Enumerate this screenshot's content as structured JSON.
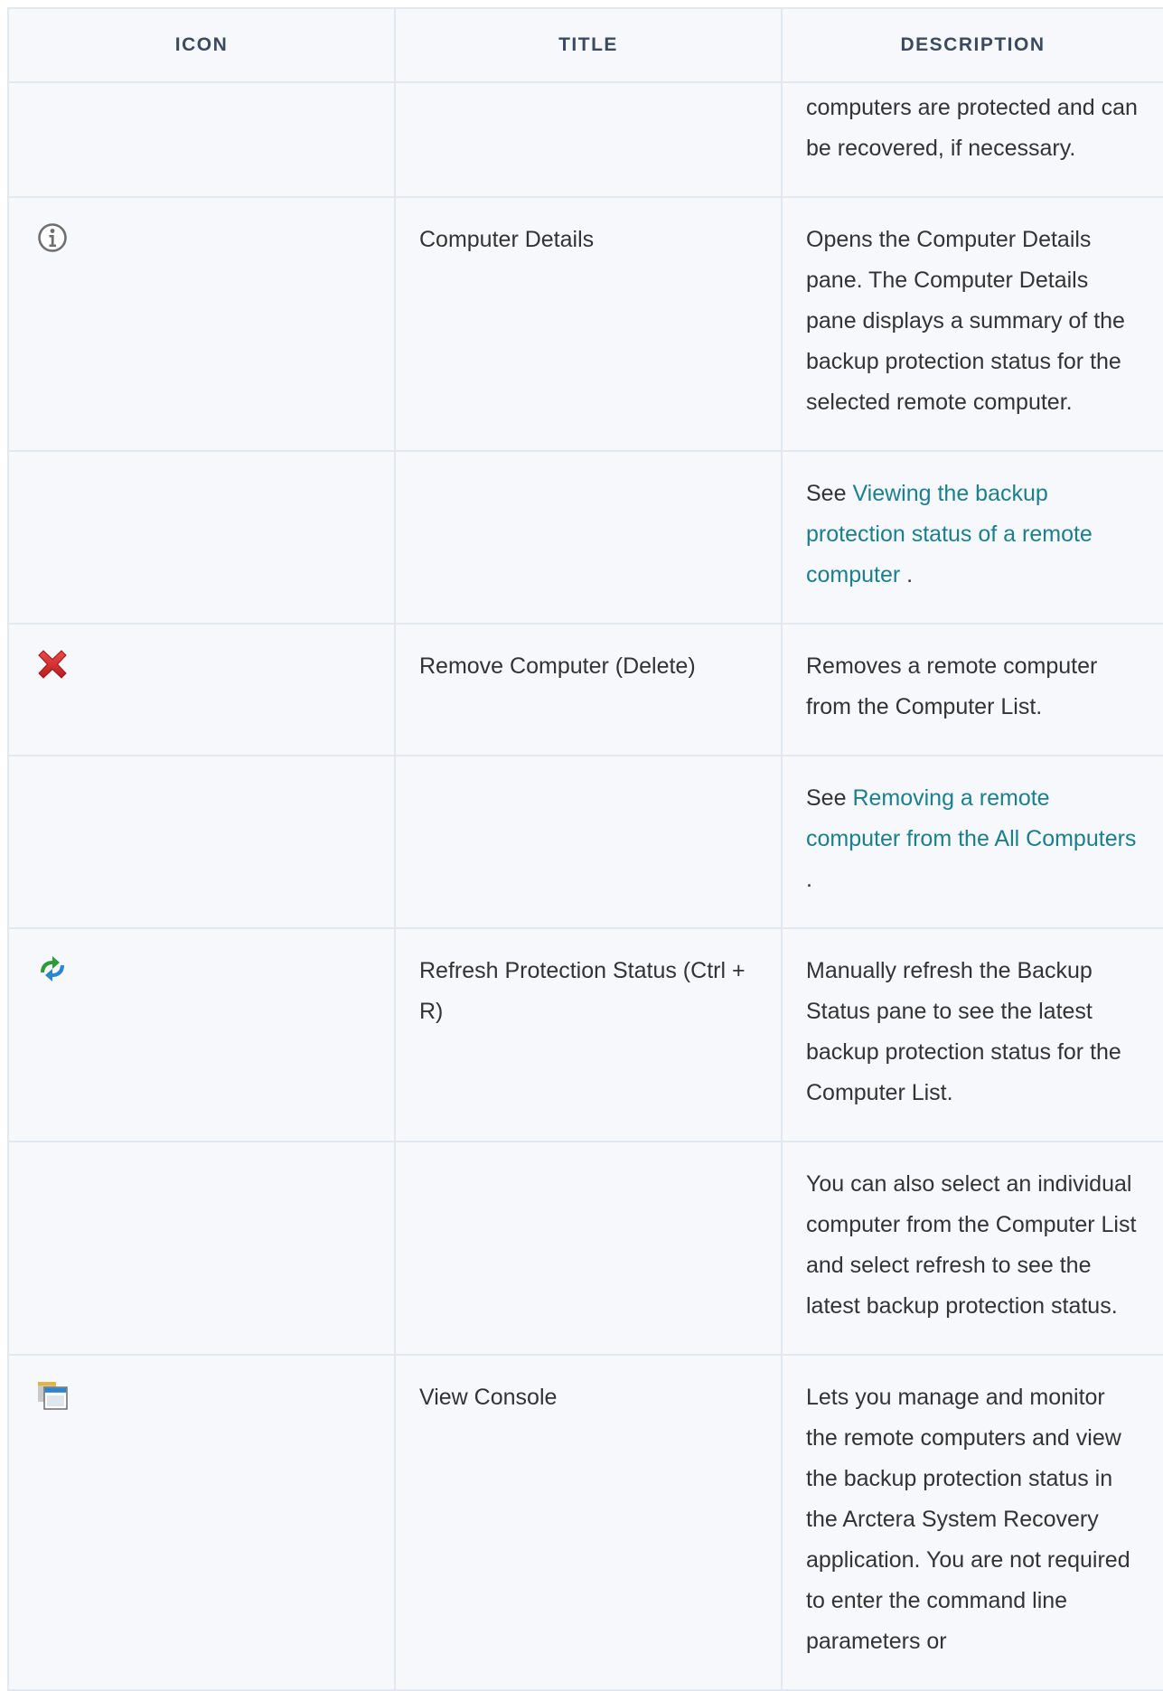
{
  "columns": {
    "icon": "ICON",
    "title": "TITLE",
    "description": "DESCRIPTION"
  },
  "rows": [
    {
      "icon": "",
      "title": "",
      "description": "computers are protected and can be recovered, if necessary."
    },
    {
      "icon": "info-icon",
      "title": "Computer Details",
      "description": "Opens the Computer Details pane. The Computer Details pane displays a summary of the backup protection status for the selected remote computer."
    },
    {
      "icon": "",
      "title": "",
      "see_prefix": "See",
      "link": "Viewing the backup protection status of a remote computer",
      "see_suffix": "."
    },
    {
      "icon": "red-x-delete-icon",
      "title": "Remove Computer (Delete)",
      "description": "Removes a remote computer from the Computer List."
    },
    {
      "icon": "",
      "title": "",
      "see_prefix": "See",
      "link": "Removing a remote computer from the All Computers",
      "see_suffix": "."
    },
    {
      "icon": "refresh-arrows-icon",
      "title": "Refresh Protection Status (Ctrl + R)",
      "description": "Manually refresh the Backup Status pane to see the latest backup protection status for the Computer List."
    },
    {
      "icon": "",
      "title": "",
      "description": "You can also select an individual computer from the Computer List and select refresh to see the latest backup protection status."
    },
    {
      "icon": "console-window-icon",
      "title": "View Console",
      "description": "Lets you manage and monitor the remote computers and view the backup protection status in the Arctera System Recovery application. You are not required to enter the command line parameters or"
    }
  ],
  "colors": {
    "link": "#1b7f8e",
    "border": "#e3e7ee",
    "header_text": "#3b4a5e",
    "body_text": "#333333",
    "cell_background": "#f6f8fb",
    "delete_red": "#d8262a",
    "refresh_green": "#2f9a3c",
    "refresh_blue": "#2a86cf"
  }
}
